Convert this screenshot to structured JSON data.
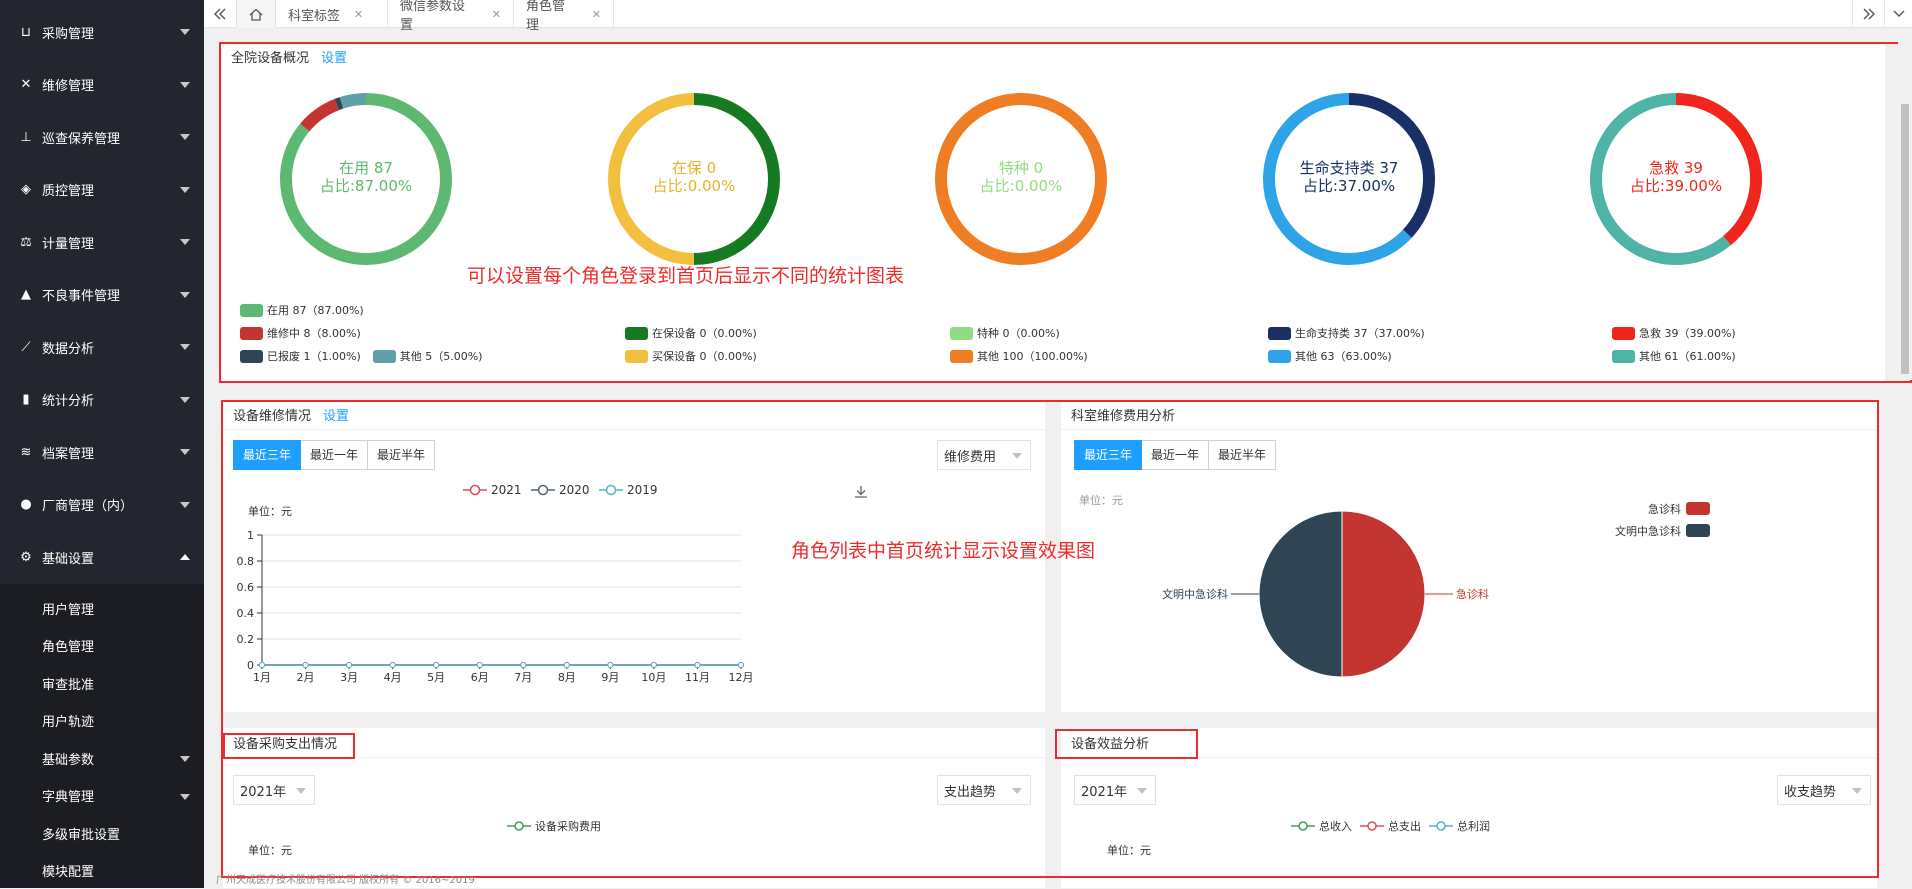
{
  "sidebar": {
    "items": [
      {
        "label": "采购管理",
        "icon": "cart-icon"
      },
      {
        "label": "维修管理",
        "icon": "wrench-icon"
      },
      {
        "label": "巡查保养管理",
        "icon": "flask-icon"
      },
      {
        "label": "质控管理",
        "icon": "shield-icon"
      },
      {
        "label": "计量管理",
        "icon": "scale-icon"
      },
      {
        "label": "不良事件管理",
        "icon": "warning-icon"
      },
      {
        "label": "数据分析",
        "icon": "line-chart-icon"
      },
      {
        "label": "统计分析",
        "icon": "bar-chart-icon"
      },
      {
        "label": "档案管理",
        "icon": "layers-icon"
      },
      {
        "label": "厂商管理（内）",
        "icon": "users-icon"
      },
      {
        "label": "基础设置",
        "icon": "gear-icon"
      }
    ],
    "sub_items": [
      {
        "label": "用户管理",
        "has_caret": false
      },
      {
        "label": "角色管理",
        "has_caret": false
      },
      {
        "label": "审查批准",
        "has_caret": false
      },
      {
        "label": "用户轨迹",
        "has_caret": false
      },
      {
        "label": "基础参数",
        "has_caret": true
      },
      {
        "label": "字典管理",
        "has_caret": true
      },
      {
        "label": "多级审批设置",
        "has_caret": false
      },
      {
        "label": "模块配置",
        "has_caret": false
      }
    ]
  },
  "tabs": [
    {
      "label": "科室标签"
    },
    {
      "label": "微信参数设置"
    },
    {
      "label": "角色管理"
    }
  ],
  "overview": {
    "title": "全院设备概况",
    "settings_link": "设置",
    "donuts": [
      {
        "center_line1": "在用 87",
        "center_line2": "占比:87.00%",
        "text_color": "#5db971",
        "segments": [
          {
            "value": 87,
            "color": "#5db971"
          },
          {
            "value": 8,
            "color": "#c23531"
          },
          {
            "value": 1,
            "color": "#2f4554"
          },
          {
            "value": 5,
            "color": "#61a0a8"
          }
        ],
        "legend": [
          [
            {
              "label": "在用 87（87.00%)",
              "color": "#5db971"
            }
          ],
          [
            {
              "label": "维修中 8（8.00%)",
              "color": "#c23531"
            }
          ],
          [
            {
              "label": "已报废 1（1.00%)",
              "color": "#2f4554"
            },
            {
              "label": "其他 5（5.00%)",
              "color": "#61a0a8"
            }
          ]
        ]
      },
      {
        "center_line1": "在保 0",
        "center_line2": "占比:0.00%",
        "text_color": "#e5b22b",
        "segments": [
          {
            "value": 50,
            "color": "#167a22"
          },
          {
            "value": 50,
            "color": "#f2c03e"
          }
        ],
        "legend": [
          [
            {
              "label": "在保设备 0（0.00%)",
              "color": "#167a22"
            }
          ],
          [
            {
              "label": "买保设备 0（0.00%)",
              "color": "#f2c03e"
            }
          ]
        ]
      },
      {
        "center_line1": "特种 0",
        "center_line2": "占比:0.00%",
        "text_color": "#91dc82",
        "segments": [
          {
            "value": 100,
            "color": "#ee7d24"
          }
        ],
        "legend": [
          [
            {
              "label": "特种 0（0.00%)",
              "color": "#91dc82"
            }
          ],
          [
            {
              "label": "其他 100（100.00%)",
              "color": "#ee7d24"
            }
          ]
        ]
      },
      {
        "center_line1": "生命支持类 37",
        "center_line2": "占比:37.00%",
        "text_color": "#1a2f66",
        "segments": [
          {
            "value": 37,
            "color": "#1a2f66"
          },
          {
            "value": 63,
            "color": "#2ea3e8"
          }
        ],
        "legend": [
          [
            {
              "label": "生命支持类 37（37.00%)",
              "color": "#1a2f66"
            }
          ],
          [
            {
              "label": "其他 63（63.00%)",
              "color": "#2ea3e8"
            }
          ]
        ]
      },
      {
        "center_line1": "急救 39",
        "center_line2": "占比:39.00%",
        "text_color": "#f0251b",
        "segments": [
          {
            "value": 39,
            "color": "#f0251b"
          },
          {
            "value": 61,
            "color": "#4fb4a6"
          }
        ],
        "legend": [
          [
            {
              "label": "急救 39（39.00%)",
              "color": "#f0251b"
            }
          ],
          [
            {
              "label": "其他 61（61.00%)",
              "color": "#4fb4a6"
            }
          ]
        ]
      }
    ]
  },
  "annotations": {
    "overview_note": "可以设置每个角色登录到首页后显示不同的统计图表",
    "middle_note": "角色列表中首页统计显示设置效果图"
  },
  "repair": {
    "title": "设备维修情况",
    "settings_link": "设置",
    "range_tabs": [
      "最近三年",
      "最近一年",
      "最近半年"
    ],
    "metric_select": "维修费用",
    "unit_label": "单位：元"
  },
  "dept_cost": {
    "title": "科室维修费用分析",
    "range_tabs": [
      "最近三年",
      "最近一年",
      "最近半年"
    ],
    "unit_label": "单位：元"
  },
  "procurement": {
    "title": "设备采购支出情况",
    "year_select": "2021年",
    "trend_select": "支出趋势",
    "legend": [
      "设备采购费用"
    ],
    "unit_label": "单位：元"
  },
  "benefit": {
    "title": "设备效益分析",
    "year_select": "2021年",
    "trend_select": "收支趋势",
    "legend": [
      "总收入",
      "总支出",
      "总利润"
    ],
    "unit_label": "单位：元"
  },
  "footer": {
    "copyright": "广州天成医疗技术股份有限公司 版权所有 © 2016~2019"
  },
  "chart_data": [
    {
      "type": "line",
      "categories": [
        "1月",
        "2月",
        "3月",
        "4月",
        "5月",
        "6月",
        "7月",
        "8月",
        "9月",
        "10月",
        "11月",
        "12月"
      ],
      "series": [
        {
          "name": "2021",
          "color": "#d94e5d",
          "values": [
            0,
            0,
            0,
            0,
            0,
            0,
            0,
            0,
            0,
            0,
            0,
            0
          ]
        },
        {
          "name": "2020",
          "color": "#556677",
          "values": [
            0,
            0,
            0,
            0,
            0,
            0,
            0,
            0,
            0,
            0,
            0,
            0
          ]
        },
        {
          "name": "2019",
          "color": "#5ab1c4",
          "values": [
            0,
            0,
            0,
            0,
            0,
            0,
            0,
            0,
            0,
            0,
            0,
            0
          ]
        }
      ],
      "yticks": [
        "0",
        "0.2",
        "0.4",
        "0.6",
        "0.8",
        "1"
      ],
      "ylim": [
        0,
        1
      ],
      "ylabel": "单位：元",
      "legend": "top-center"
    },
    {
      "type": "pie",
      "labels": [
        "急诊科",
        "文明中急诊科"
      ],
      "values": [
        50,
        50
      ],
      "colors": [
        "#c23531",
        "#2f4554"
      ],
      "legend": "top-right"
    }
  ]
}
